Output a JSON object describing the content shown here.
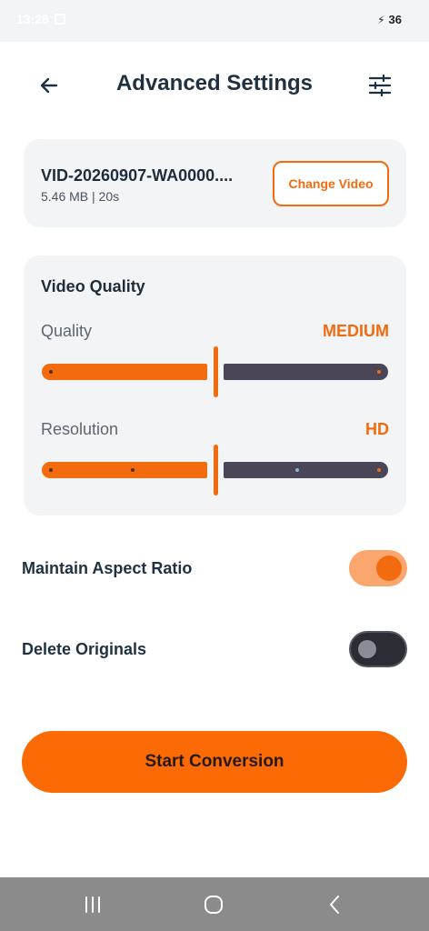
{
  "status_bar": {
    "time": "13:28",
    "battery": "36"
  },
  "header": {
    "title": "Advanced Settings",
    "back_icon": "arrow-left-icon",
    "settings_icon": "tune-sliders-icon"
  },
  "video": {
    "name": "VID-20260907-WA0000....",
    "meta": "5.46 MB | 20s",
    "change_label": "Change Video"
  },
  "video_quality": {
    "title": "Video Quality",
    "quality": {
      "label": "Quality",
      "value": "MEDIUM",
      "position": 0.5,
      "steps": 3
    },
    "resolution": {
      "label": "Resolution",
      "value": "HD",
      "position": 0.5,
      "steps": 5
    }
  },
  "options": {
    "maintain_aspect_ratio": {
      "label": "Maintain Aspect Ratio",
      "enabled": true
    },
    "delete_originals": {
      "label": "Delete Originals",
      "enabled": false
    }
  },
  "actions": {
    "start_label": "Start Conversion"
  },
  "navigation": {
    "recents_icon": "recents-icon",
    "home_icon": "home-icon",
    "back_icon": "back-chevron-icon"
  },
  "colors": {
    "accent": "#f26b0f",
    "inactive_track": "#4a4658",
    "card_bg": "#f2f4f6"
  }
}
